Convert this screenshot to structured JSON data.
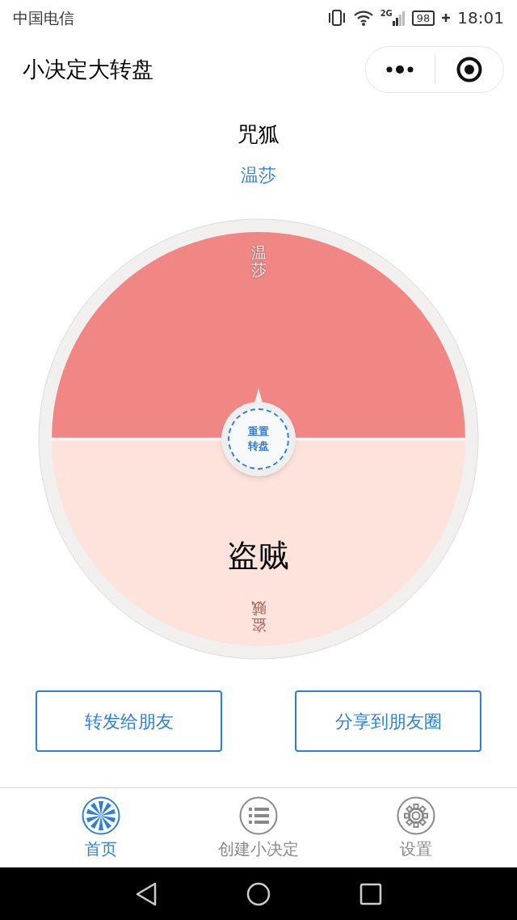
{
  "status_bar": {
    "carrier": "中国电信",
    "network": "2G",
    "battery": "98",
    "time": "18:01"
  },
  "nav": {
    "title": "小决定大转盘"
  },
  "question": "咒狐",
  "answer": "温莎",
  "wheel": {
    "segments": [
      {
        "label": "温莎",
        "color": "#f08784"
      },
      {
        "label": "盗贼",
        "color": "#fde3dc"
      }
    ],
    "center_button": [
      "重置",
      "转盘"
    ],
    "result": "盗贼"
  },
  "buttons": [
    "转发给朋友",
    "分享到朋友圈"
  ],
  "tabs": [
    {
      "label": "首页",
      "selected": true
    },
    {
      "label": "创建小决定",
      "selected": false
    },
    {
      "label": "设置",
      "selected": false
    }
  ]
}
